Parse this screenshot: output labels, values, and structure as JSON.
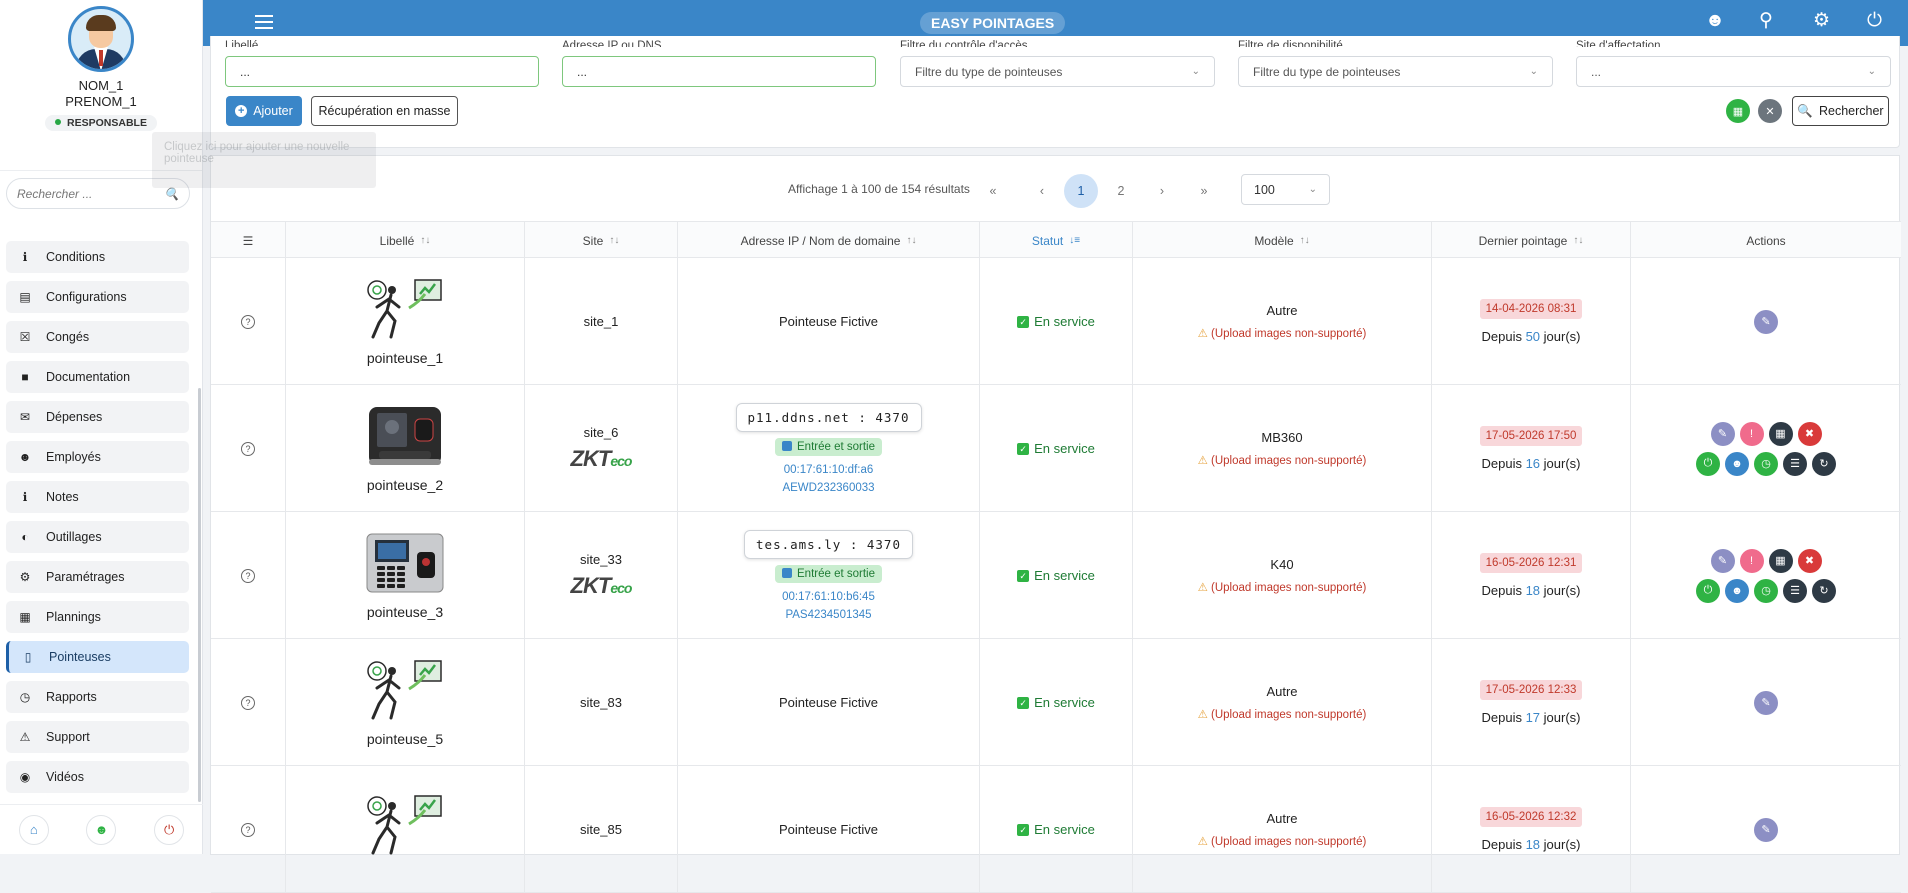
{
  "app": {
    "title": "EASY POINTAGES"
  },
  "user": {
    "first_line": "NOM_1",
    "second_line": "PRENOM_1",
    "role": "RESPONSABLE"
  },
  "tooltip": "Cliquez ici pour ajouter une nouvelle pointeuse",
  "sidebar": {
    "search_placeholder": "Rechercher ...",
    "items": [
      {
        "label": "Conditions",
        "icon": "info-icon"
      },
      {
        "label": "Configurations",
        "icon": "id-card-icon"
      },
      {
        "label": "Congés",
        "icon": "calendar-x-icon"
      },
      {
        "label": "Documentation",
        "icon": "folder-icon"
      },
      {
        "label": "Dépenses",
        "icon": "envelope-icon"
      },
      {
        "label": "Employés",
        "icon": "user-plus-icon"
      },
      {
        "label": "Notes",
        "icon": "info-icon"
      },
      {
        "label": "Outillages",
        "icon": "half-circle-icon"
      },
      {
        "label": "Paramétrages",
        "icon": "gears-icon"
      },
      {
        "label": "Plannings",
        "icon": "calendar-icon"
      },
      {
        "label": "Pointeuses",
        "icon": "device-icon"
      },
      {
        "label": "Rapports",
        "icon": "clock-icon"
      },
      {
        "label": "Support",
        "icon": "warning-icon"
      },
      {
        "label": "Vidéos",
        "icon": "camera-icon"
      }
    ]
  },
  "filters": {
    "libelle": {
      "label": "Libellé",
      "value": "..."
    },
    "adresse": {
      "label": "Adresse IP ou DNS",
      "value": "..."
    },
    "controle": {
      "label": "Filtre du contrôle d'accès",
      "placeholder": "Filtre du type de pointeuses"
    },
    "dispo": {
      "label": "Filtre de disponibilité",
      "placeholder": "Filtre du type de pointeuses"
    },
    "site": {
      "label": "Site d'affectation",
      "value": "..."
    },
    "add_label": "Ajouter",
    "mass_label": "Récupération en masse",
    "search_label": "Rechercher"
  },
  "pagination": {
    "info": "Affichage 1 à 100 de 154 résultats",
    "pages": [
      "1",
      "2"
    ],
    "current": "1",
    "first": "«",
    "prev": "‹",
    "next": "›",
    "last": "»",
    "page_size": "100"
  },
  "columns": [
    "Libellé",
    "Site",
    "Adresse IP / Nom de domaine",
    "Statut",
    "Modèle",
    "Dernier pointage",
    "Actions"
  ],
  "rows": [
    {
      "name": "pointeuse_1",
      "image": "fictive-icon",
      "site": "site_1",
      "zk": false,
      "ip": "Pointeuse Fictive",
      "fictive": true,
      "status": "En service",
      "model": "Autre",
      "warn": "(Upload images non-supporté)",
      "date": "14-04-2026 08:31",
      "since_pre": "Depuis",
      "since_n": "50",
      "since_post": "jour(s)",
      "actions": "edit"
    },
    {
      "name": "pointeuse_2",
      "image": "faceid-device",
      "site": "site_6",
      "zk": true,
      "ip": "p11.ddns.net : 4370",
      "fictive": false,
      "io": "Entrée et sortie",
      "mac": "00:17:61:10:df:a6",
      "serial": "AEWD232360033",
      "status": "En service",
      "model": "MB360",
      "warn": "(Upload images non-supporté)",
      "date": "17-05-2026 17:50",
      "since_pre": "Depuis",
      "since_n": "16",
      "since_post": "jour(s)",
      "actions": "full"
    },
    {
      "name": "pointeuse_3",
      "image": "keypad-device",
      "site": "site_33",
      "zk": true,
      "ip": "tes.ams.ly : 4370",
      "fictive": false,
      "io": "Entrée et sortie",
      "mac": "00:17:61:10:b6:45",
      "serial": "PAS4234501345",
      "status": "En service",
      "model": "K40",
      "warn": "(Upload images non-supporté)",
      "date": "16-05-2026 12:31",
      "since_pre": "Depuis",
      "since_n": "18",
      "since_post": "jour(s)",
      "actions": "full"
    },
    {
      "name": "pointeuse_5",
      "image": "fictive-icon",
      "site": "site_83",
      "zk": false,
      "ip": "Pointeuse Fictive",
      "fictive": true,
      "status": "En service",
      "model": "Autre",
      "warn": "(Upload images non-supporté)",
      "date": "17-05-2026 12:33",
      "since_pre": "Depuis",
      "since_n": "17",
      "since_post": "jour(s)",
      "actions": "edit"
    },
    {
      "name": "",
      "image": "fictive-icon",
      "site": "site_85",
      "zk": false,
      "ip": "Pointeuse Fictive",
      "fictive": true,
      "status": "En service",
      "model": "Autre",
      "warn": "(Upload images non-supporté)",
      "date": "16-05-2026 12:32",
      "since_pre": "Depuis",
      "since_n": "18",
      "since_post": "jour(s)",
      "actions": "edit"
    }
  ],
  "zk_logo": {
    "main": "ZKT",
    "sub": "eco"
  },
  "colors": {
    "primary": "#3a86c8",
    "success": "#2fb344",
    "danger": "#c0392b",
    "active_bg": "#d4e6fb"
  }
}
